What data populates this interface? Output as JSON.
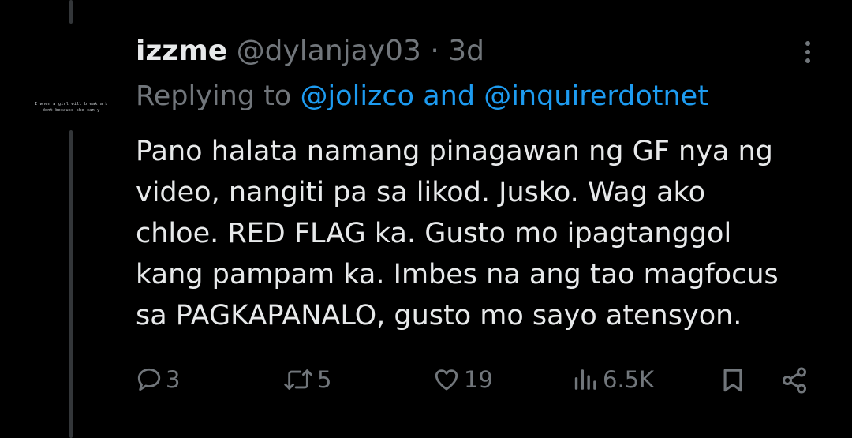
{
  "tweet": {
    "display_name": "izzme",
    "handle": "@dylanjay03",
    "separator": "·",
    "time": "3d",
    "replying_prefix": "Replying to ",
    "reply_to_1": "@jolizco",
    "reply_and": " and ",
    "reply_to_2": "@inquirerdotnet",
    "text": "Pano halata namang pinagawan ng GF nya ng\nvideo, nangiti pa sa likod. Jusko. Wag ako\nchloe. RED FLAG ka. Gusto mo ipagtanggol\nkang pampam ka. Imbes na ang tao magfocus\nsa PAGKAPANALO, gusto mo sayo atensyon.",
    "avatar_art": "I when a girl will break a boy\ndont because she can y"
  },
  "actions": {
    "replies": "3",
    "retweets": "5",
    "likes": "19",
    "views": "6.5K"
  },
  "icons": {
    "reply": "speech-bubble-icon",
    "retweet": "retweet-arrows-icon",
    "like": "heart-icon",
    "views": "bar-chart-icon",
    "bookmark": "bookmark-icon",
    "share": "share-nodes-icon",
    "more": "vertical-ellipsis-icon"
  },
  "colors": {
    "background": "#000000",
    "primary_text": "#e7e9ea",
    "secondary_text": "#71767b",
    "link": "#1d9bf0",
    "thread_line": "#333639"
  }
}
